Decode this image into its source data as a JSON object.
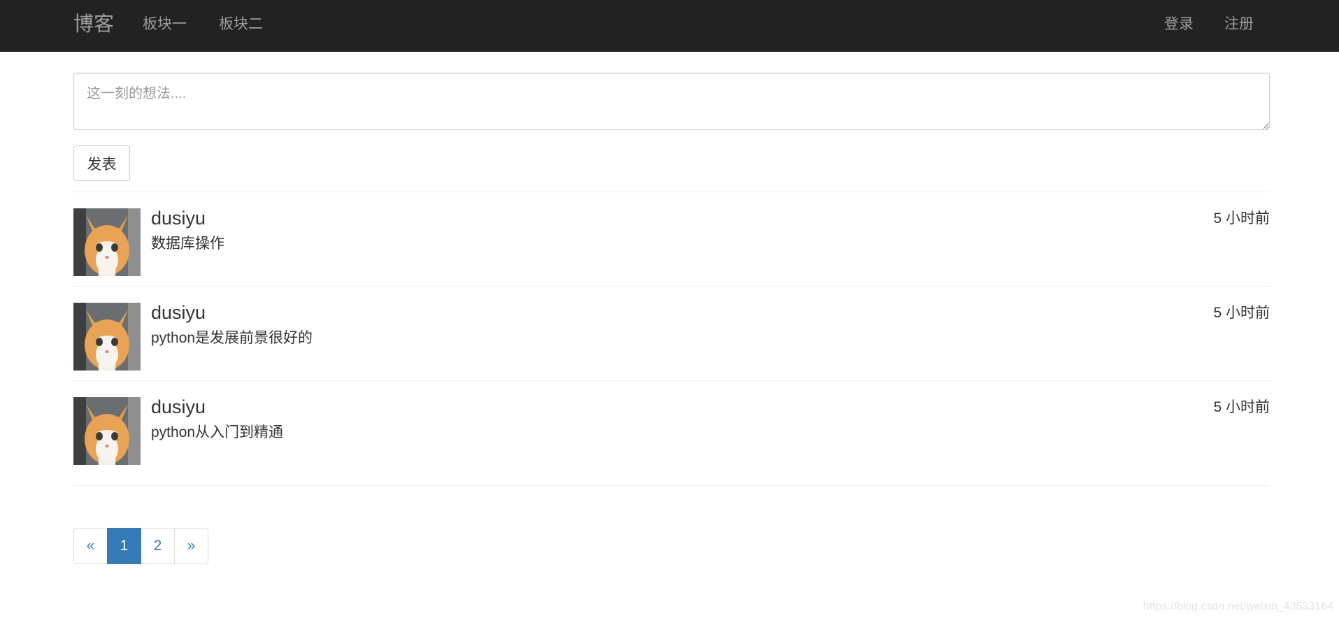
{
  "navbar": {
    "brand": "博客",
    "left_links": [
      "板块一",
      "板块二"
    ],
    "login": "登录",
    "register": "注册",
    "background": "#222222",
    "link_color": "#9d9d9d"
  },
  "composer": {
    "placeholder": "这一刻的想法....",
    "submit_label": "发表"
  },
  "posts": [
    {
      "author": "dusiyu",
      "content": "数据库操作",
      "time": "5 小时前",
      "avatar": "cat-avatar"
    },
    {
      "author": "dusiyu",
      "content": "python是发展前景很好的",
      "time": "5 小时前",
      "avatar": "cat-avatar"
    },
    {
      "author": "dusiyu",
      "content": "python从入门到精通",
      "time": "5 小时前",
      "avatar": "cat-avatar"
    }
  ],
  "pagination": {
    "prev": "«",
    "pages": [
      "1",
      "2"
    ],
    "active_page": "1",
    "next": "»",
    "accent": "#337ab7"
  },
  "watermark": "https://blog.csdn.net/weixin_43533164"
}
